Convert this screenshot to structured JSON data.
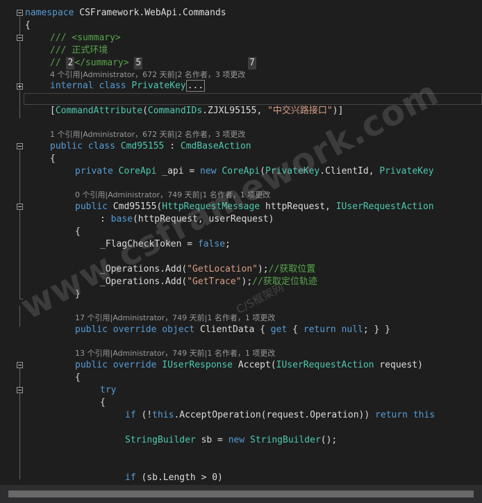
{
  "lines": {
    "ns_kw": "namespace",
    "ns_name": " CSFramework.WebApi.Commands",
    "brace_open": "{",
    "sum1": "/// <summary>",
    "sum2": "/// 正式环境",
    "sum3_pre": "//",
    "sum3_num1": "2",
    "sum3_mid": "</summary>",
    "sum3_num2": "5",
    "sum3_num3": "7",
    "lens1": "4 个引用|Administrator，672 天前|2 名作者，3 项更改",
    "pk_kw1": "internal",
    "pk_kw2": "class",
    "pk_name": "PrivateKey",
    "pk_collapsed": "...",
    "attr_open": "[",
    "attr_name": "CommandAttribute",
    "attr_paren": "(",
    "attr_ids": "CommandIDs",
    "attr_member": ".ZJXL95155, ",
    "attr_str": "\"中交兴路接口\"",
    "attr_close": ")]",
    "lens2": "1 个引用|Administrator，672 天前|2 名作者，3 项更改",
    "cls_kw1": "public",
    "cls_kw2": "class",
    "cls_name": "Cmd95155",
    "cls_colon": " : ",
    "cls_base": "CmdBaseAction",
    "brace2": "{",
    "api_kw": "private",
    "api_type": "CoreApi",
    "api_field": " _api = ",
    "api_new": "new",
    "api_type2": "CoreApi",
    "api_args": "(",
    "api_pk": "PrivateKey",
    "api_rest": ".ClientId, ",
    "api_pk2": "PrivateKey",
    "lens3": "0 个引用|Administrator，749 天前|1 名作者，1 项更改",
    "ctor_kw": "public",
    "ctor_name": " Cmd95155(",
    "ctor_t1": "HttpRequestMessage",
    "ctor_p1": " httpRequest, ",
    "ctor_t2": "IUserRequestAction",
    "base_pre": ": ",
    "base_kw": "base",
    "base_args": "(httpRequest, userRequest)",
    "brace3": "{",
    "flag_field": "_FlagCheckToken = ",
    "flag_val": "false",
    "flag_end": ";",
    "op1_pre": "_Operations.Add(",
    "op1_str": "\"GetLocation\"",
    "op1_end": ");",
    "op1_cm": "//获取位置",
    "op2_pre": "_Operations.Add(",
    "op2_str": "\"GetTrace\"",
    "op2_end": ");",
    "op2_cm": "//获取定位轨迹",
    "brace3_close": "}",
    "lens4": "17 个引用|Administrator，749 天前|1 名作者，1 项更改",
    "cd_kw1": "public",
    "cd_kw2": "override",
    "cd_kw3": "object",
    "cd_name": " ClientData { ",
    "cd_get": "get",
    "cd_b": " { ",
    "cd_ret": "return",
    "cd_null": "null",
    "cd_end": "; } }",
    "lens5": "13 个引用|Administrator，749 天前|1 名作者，1 项更改",
    "acc_kw1": "public",
    "acc_kw2": "override",
    "acc_type": "IUserResponse",
    "acc_name": " Accept(",
    "acc_ptype": "IUserRequestAction",
    "acc_pname": " request)",
    "brace4": "{",
    "try_kw": "try",
    "brace5": "{",
    "if1_kw": "if",
    "if1_a": " (!",
    "if1_this": "this",
    "if1_b": ".AcceptOperation(request.Operation)) ",
    "if1_ret": "return",
    "if1_this2": "this",
    "sb_type": "StringBuilder",
    "sb_var": " sb = ",
    "sb_new": "new",
    "sb_type2": "StringBuilder",
    "sb_end": "();",
    "if2_kw": "if",
    "if2_rest": " (sb.Length > 0)"
  },
  "watermark": {
    "text": "www.csframework.com",
    "sub": "C/S框架网"
  },
  "colors": {
    "background": "#1e1e1e",
    "keyword": "#569cd6",
    "type": "#4ec9b0",
    "comment": "#57a64a",
    "string": "#d69d85"
  }
}
